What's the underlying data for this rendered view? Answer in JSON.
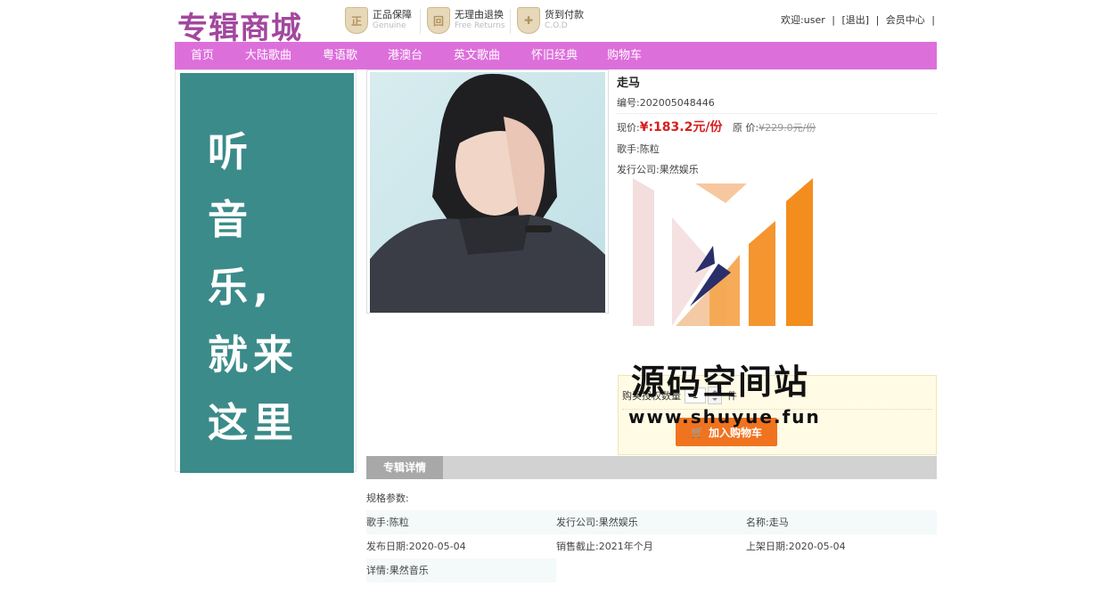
{
  "header": {
    "logo": "专辑商城",
    "promises": [
      {
        "icon": "genuine-shield-icon",
        "title": "正品保障",
        "sub": "Genuine",
        "badge": "正"
      },
      {
        "icon": "return-shield-icon",
        "title": "无理由退换",
        "sub": "Free Returns",
        "badge": "回"
      },
      {
        "icon": "cod-box-icon",
        "title": "货到付款",
        "sub": "C.O.D",
        "badge": "✚"
      }
    ],
    "user": {
      "welcome": "欢迎:user",
      "sep": "|",
      "logout": "[退出]",
      "member": "会员中心"
    }
  },
  "nav": [
    "首页",
    "大陆歌曲",
    "粤语歌",
    "港澳台",
    "英文歌曲",
    "怀旧经典",
    "购物车"
  ],
  "banner": {
    "lines": [
      "听",
      "音",
      "乐,",
      "就来",
      "这里"
    ]
  },
  "product": {
    "name": "走马",
    "code": "编号:202005048446",
    "price_label": "现价:",
    "price": "¥:183.2元/份",
    "orig_label": "原 价:",
    "orig_price": "¥229.0元/份",
    "singer": "歌手:陈粒",
    "publisher": "发行公司:果然娱乐"
  },
  "buy": {
    "qty_label": "购买授权数量",
    "qty": "1",
    "unit": "件",
    "add_button": "加入购物车"
  },
  "details": {
    "tab": "专辑详情",
    "spec_title": "规格参数:",
    "rows": [
      [
        "歌手:陈粒",
        "发行公司:果然娱乐",
        "名称:走马"
      ],
      [
        "发布日期:2020-05-04",
        "销售截止:2021年个月",
        "上架日期:2020-05-04"
      ]
    ],
    "desc": "详情:果然音乐"
  },
  "watermark": {
    "title": "源码空间站",
    "url": "www.shuyue.fun"
  },
  "colors": {
    "nav": "#dd6fdb",
    "logo": "#a2479f",
    "banner": "#3b8b8a",
    "price": "#d71f1f",
    "button": "#f0731f"
  }
}
